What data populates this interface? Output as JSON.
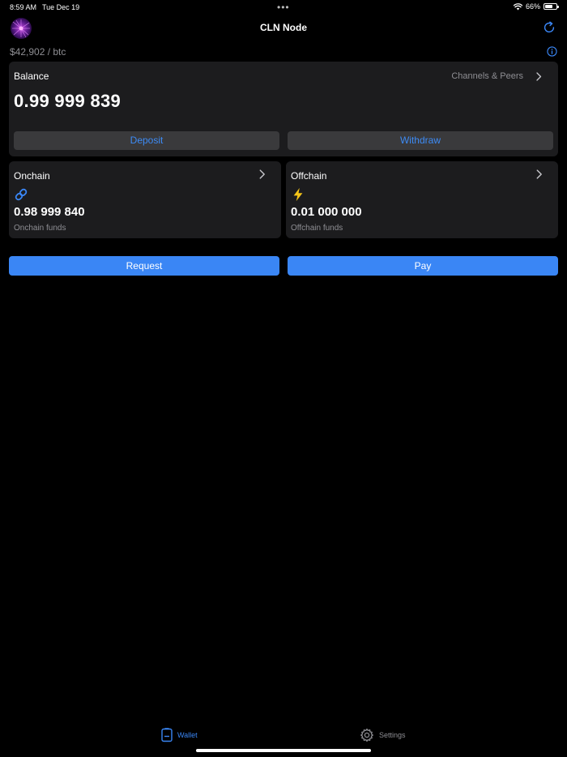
{
  "status": {
    "time": "8:59 AM",
    "date": "Tue Dec 19",
    "dots": "•••",
    "battery": "66%",
    "battery_level": 0.66
  },
  "nav": {
    "title": "CLN Node",
    "avatar_icon": "node-avatar",
    "refresh_icon": "refresh-icon"
  },
  "price": "$42,902 / btc",
  "balance": {
    "label": "Balance",
    "channels_link": "Channels & Peers",
    "amount": "0.99 999 839",
    "deposit_label": "Deposit",
    "withdraw_label": "Withdraw"
  },
  "onchain": {
    "title": "Onchain",
    "icon": "link-icon",
    "value": "0.98 999 840",
    "caption": "Onchain funds"
  },
  "offchain": {
    "title": "Offchain",
    "icon": "lightning-icon",
    "value": "0.01 000 000",
    "caption": "Offchain funds"
  },
  "actions": {
    "request_label": "Request",
    "pay_label": "Pay"
  },
  "tabs": [
    {
      "label": "Wallet",
      "icon": "wallet-icon",
      "active": true
    },
    {
      "label": "Settings",
      "icon": "gear-icon",
      "active": false
    }
  ],
  "colors": {
    "accent": "#3a86f5",
    "card": "#1c1c1e",
    "secondary_button": "#3a3a3c",
    "muted_text": "#8e8e93",
    "lightning": "#f5c518"
  }
}
